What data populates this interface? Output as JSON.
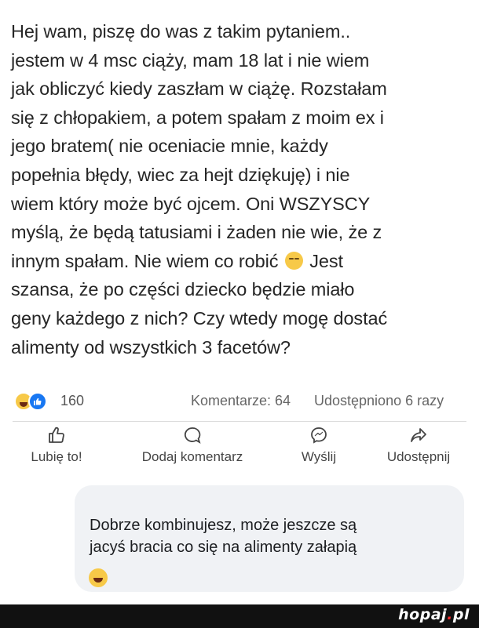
{
  "post": {
    "lines": [
      "Hej wam, piszę do was z takim pytaniem..",
      "jestem w 4 msc ciąży, mam 18 lat i nie wiem",
      "jak obliczyć kiedy zaszłam w ciążę. Rozstałam",
      "się z chłopakiem, a potem spałam z moim ex i",
      "jego bratem( nie oceniacie mnie, każdy",
      "popełnia błędy, wiec za hejt dziękuję)  i nie",
      "wiem który może być ojcem. Oni WSZYSCY",
      "myślą, że będą tatusiami i żaden nie wie, że  z",
      "innym spałam. Nie wiem co robić",
      "Jest",
      "szansa, że po części dziecko będzie miało",
      "geny każdego z nich? Czy wtedy mogę dostać",
      "alimenty od wszystkich 3 facetów?"
    ]
  },
  "reactions": {
    "count": "160",
    "icons": [
      "haha-icon",
      "like-icon"
    ],
    "comments": "Komentarze: 64",
    "shares": "Udostępniono 6 razy"
  },
  "actions": {
    "like": "Lubię to!",
    "comment": "Dodaj komentarz",
    "send": "Wyślij",
    "share": "Udostępnij"
  },
  "comment": {
    "lines": [
      "Dobrze kombinujesz,  może jeszcze są",
      "jacyś bracia co się na alimenty załapią"
    ],
    "emoji": "laughing-emoji"
  },
  "footer": {
    "brand": "hopaj",
    "dot": ".",
    "tld": "pl"
  },
  "colors": {
    "like_blue": "#1877f2",
    "bubble_bg": "#f0f2f5",
    "footer_bg": "#111111",
    "brand_red": "#ff2b2b"
  }
}
